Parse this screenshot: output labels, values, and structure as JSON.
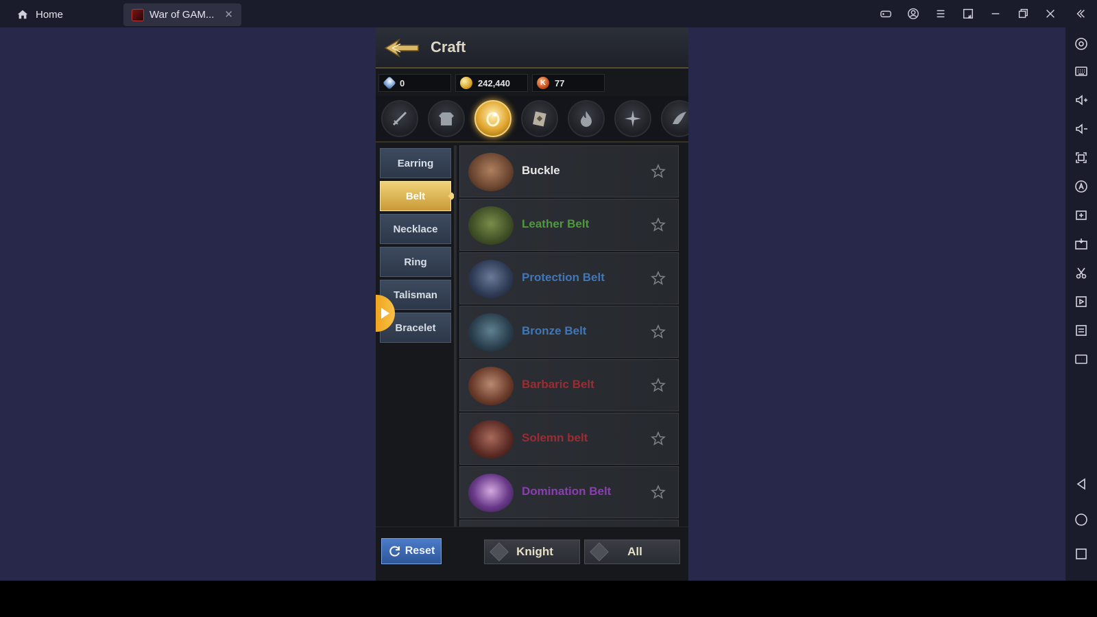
{
  "titlebar": {
    "home_label": "Home",
    "game_tab_label": "War of GAM...",
    "close_tab": "✕"
  },
  "game": {
    "title": "Craft",
    "currencies": [
      {
        "name": "diamond",
        "value": "0"
      },
      {
        "name": "gold",
        "value": "242,440"
      },
      {
        "name": "k-token",
        "value": "77",
        "icon_letter": "K"
      }
    ],
    "categories": [
      "weapon",
      "armor",
      "accessory",
      "book",
      "flame",
      "star",
      "wing"
    ],
    "active_category": "accessory",
    "subtabs": [
      "Earring",
      "Belt",
      "Necklace",
      "Ring",
      "Talisman",
      "Bracelet"
    ],
    "active_subtab": "Belt",
    "items": [
      {
        "name": "Buckle",
        "color": "#e8e8e8"
      },
      {
        "name": "Leather Belt",
        "color": "#4e9a3c"
      },
      {
        "name": "Protection Belt",
        "color": "#3f77b8"
      },
      {
        "name": "Bronze Belt",
        "color": "#3f77b8"
      },
      {
        "name": "Barbaric Belt",
        "color": "#9b2d32"
      },
      {
        "name": "Solemn belt",
        "color": "#9b2d32"
      },
      {
        "name": "Domination Belt",
        "color": "#8a3fb0"
      }
    ],
    "footer": {
      "reset_label": "Reset",
      "class_filter": "Knight",
      "grade_filter": "All"
    }
  },
  "colors": {
    "play_background": "#28284a",
    "chrome_background": "#1b1c2b",
    "accent_gold": "#e2a730",
    "reset_blue": "#3a67b0"
  }
}
